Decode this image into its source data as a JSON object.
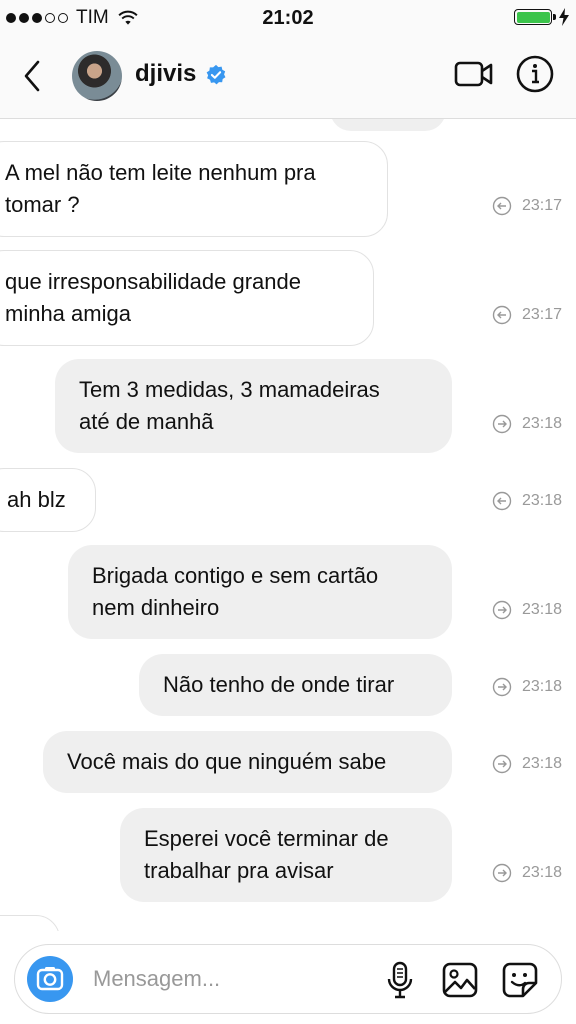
{
  "status_bar": {
    "carrier": "TIM",
    "time": "21:02",
    "signal_bars_filled": 3,
    "signal_bars_total": 5,
    "battery_level": 1.0,
    "battery_color": "#3bc44b"
  },
  "header": {
    "username": "djivis",
    "verified": true,
    "verified_color": "#3897f0"
  },
  "messages": [
    {
      "direction": "received",
      "lines": [
        "A mel não tem leite nenhum pra",
        "tomar ?"
      ],
      "time": "23:17"
    },
    {
      "direction": "received",
      "lines": [
        "que irresponsabilidade grande",
        "minha amiga"
      ],
      "time": "23:17"
    },
    {
      "direction": "sent",
      "lines": [
        "Tem 3 medidas, 3 mamadeiras",
        "até de manhã"
      ],
      "time": "23:18"
    },
    {
      "direction": "received",
      "lines": [
        "ah blz"
      ],
      "time": "23:18"
    },
    {
      "direction": "sent",
      "lines": [
        "Brigada contigo e sem cartão",
        "nem dinheiro"
      ],
      "time": "23:18"
    },
    {
      "direction": "sent",
      "lines": [
        "Não tenho de onde tirar"
      ],
      "time": "23:18"
    },
    {
      "direction": "sent",
      "lines": [
        "Você mais do que ninguém sabe"
      ],
      "time": "23:18"
    },
    {
      "direction": "sent",
      "lines": [
        "Esperei você terminar de",
        "trabalhar pra avisar"
      ],
      "time": "23:18"
    }
  ],
  "composer": {
    "placeholder": "Mensagem...",
    "camera_color": "#3897f0"
  },
  "icons": {
    "back": "chevron-left-icon",
    "video": "video-camera-icon",
    "info": "info-icon",
    "camera": "camera-icon",
    "mic": "microphone-icon",
    "gallery": "image-icon",
    "sticker": "sticker-icon"
  }
}
